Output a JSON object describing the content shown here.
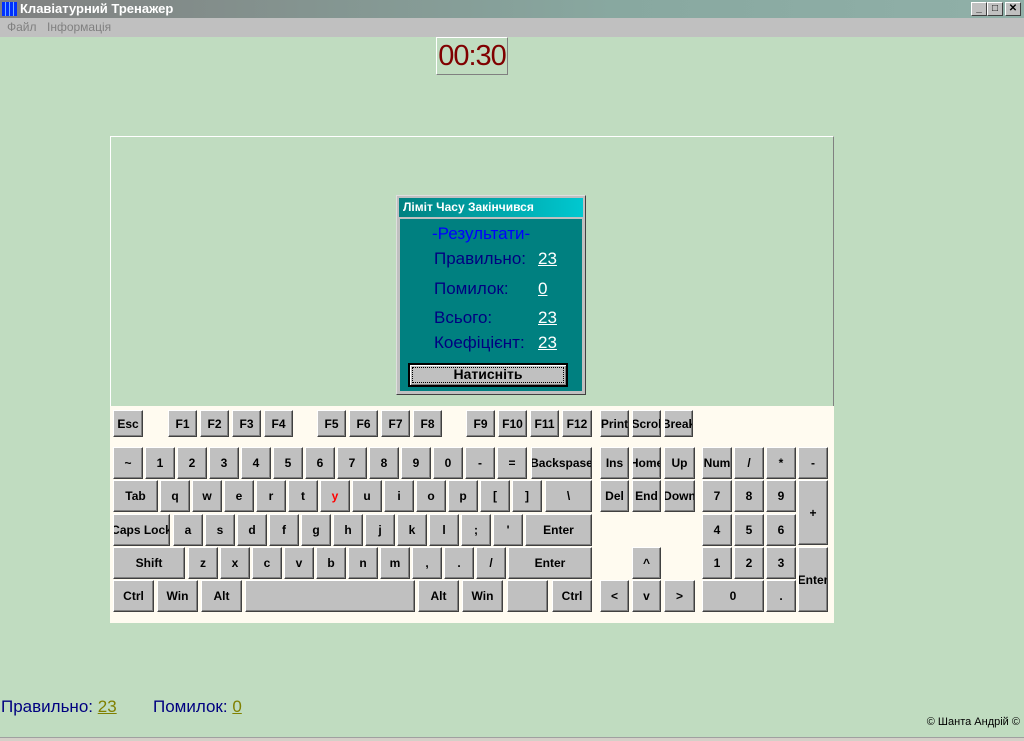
{
  "window": {
    "title": "Клавіатурний Тренажер",
    "minimize": "_",
    "maximize": "□",
    "close": "✕"
  },
  "menu": [
    "Файл",
    "Інформація"
  ],
  "timer": "00:30",
  "dialog": {
    "title": "Ліміт Часу Закінчився",
    "heading": "-Результати-",
    "rows": [
      {
        "label": "Правильно:",
        "value": "23"
      },
      {
        "label": "Помилок:",
        "value": "0"
      },
      {
        "label": "Всього:",
        "value": "23"
      },
      {
        "label": "Коефіцієнт:",
        "value": "23"
      }
    ],
    "button": "Натисніть"
  },
  "keyboard": {
    "highlight_color": "#ff0000",
    "highlighted_key": "y",
    "keys": [
      "Esc",
      "F1",
      "F2",
      "F3",
      "F4",
      "F5",
      "F6",
      "F7",
      "F8",
      "F9",
      "F10",
      "F11",
      "F12",
      "Print",
      "Scrol",
      "Break",
      "~",
      "1",
      "2",
      "3",
      "4",
      "5",
      "6",
      "7",
      "8",
      "9",
      "0",
      "-",
      "=",
      "Backspase",
      "Tab",
      "q",
      "w",
      "e",
      "r",
      "t",
      "y",
      "u",
      "i",
      "o",
      "p",
      "[",
      "]",
      "\\",
      "Caps Lock",
      "a",
      "s",
      "d",
      "f",
      "g",
      "h",
      "j",
      "k",
      "l",
      ";",
      "'",
      "Enter",
      "Shift",
      "z",
      "x",
      "c",
      "v",
      "b",
      "n",
      "m",
      ",",
      ".",
      "/",
      "Enter",
      "Ctrl",
      "Win",
      "Alt",
      "",
      "Alt",
      "Win",
      "",
      "Ctrl",
      "Ins",
      "Home",
      "Up",
      "Del",
      "End",
      "Down",
      "^",
      "<",
      "v",
      ">",
      "Num",
      "/",
      "*",
      "-",
      "7",
      "8",
      "9",
      "+",
      "4",
      "5",
      "6",
      "1",
      "2",
      "3",
      "Enter",
      "0",
      "."
    ]
  },
  "status": {
    "correct_label": "Правильно:",
    "correct": "23",
    "errors_label": "Помилок:",
    "errors": "0"
  },
  "copyright": "© Шанта Андрій ©"
}
